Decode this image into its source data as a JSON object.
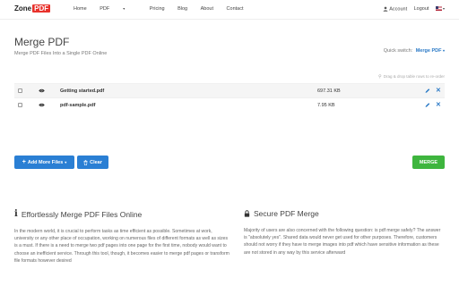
{
  "nav": {
    "logo_text": "Zone",
    "logo_badge": "PDF",
    "menu": [
      "Home",
      "PDF",
      "Pricing",
      "Blog",
      "About",
      "Contact"
    ],
    "account": "Account",
    "logout": "Logout",
    "flag": "us-flag"
  },
  "header": {
    "title": "Merge PDF",
    "subtitle": "Merge PDF Files Into a Single PDF Online",
    "quick_switch_label": "Quick switch:",
    "quick_switch_value": "Merge PDF",
    "drag_hint": "Drag & drop table rows to re-order"
  },
  "files": [
    {
      "name": "Getting started.pdf",
      "size": "697.31 KB"
    },
    {
      "name": "pdf-sample.pdf",
      "size": "7.95 KB"
    }
  ],
  "actions": {
    "add_more": "Add More Files",
    "clear": "Clear",
    "merge": "MERGE"
  },
  "info": {
    "left_title": "Effortlessly Merge PDF Files Online",
    "left_text": "In the modern world, it is crucial to perform tasks as time efficient as possible. Sometimes at work, university or any other place of occupation, working on numerous files of different formats as well as sizes is a must. If there is a need to merge two pdf pages into one page for the first time, nobody would want to choose an inefficient service. Through this tool, though, it becomes easier to merge pdf pages or transform file formats however desired",
    "right_title": "Secure PDF Merge",
    "right_text": "Majority of users are also concerned with the following question: is pdf merge safely? The answer is \"absolutely yes\". Shared data would never get used for other purposes. Therefore, customers should not worry if they have to merge images into pdf which have sensitive information as these are not stored in any way by this service afterward"
  },
  "colors": {
    "accent": "#2a7fd4",
    "merge": "#3eb53e",
    "logo_badge": "#e8322c"
  },
  "icons": {
    "preview": "eye-icon",
    "edit": "pencil-icon",
    "delete": "close-icon",
    "info": "info-icon",
    "secure": "lock-icon",
    "add": "plus-icon",
    "clear": "trash-icon",
    "pin": "map-marker-icon",
    "account": "user-icon"
  }
}
